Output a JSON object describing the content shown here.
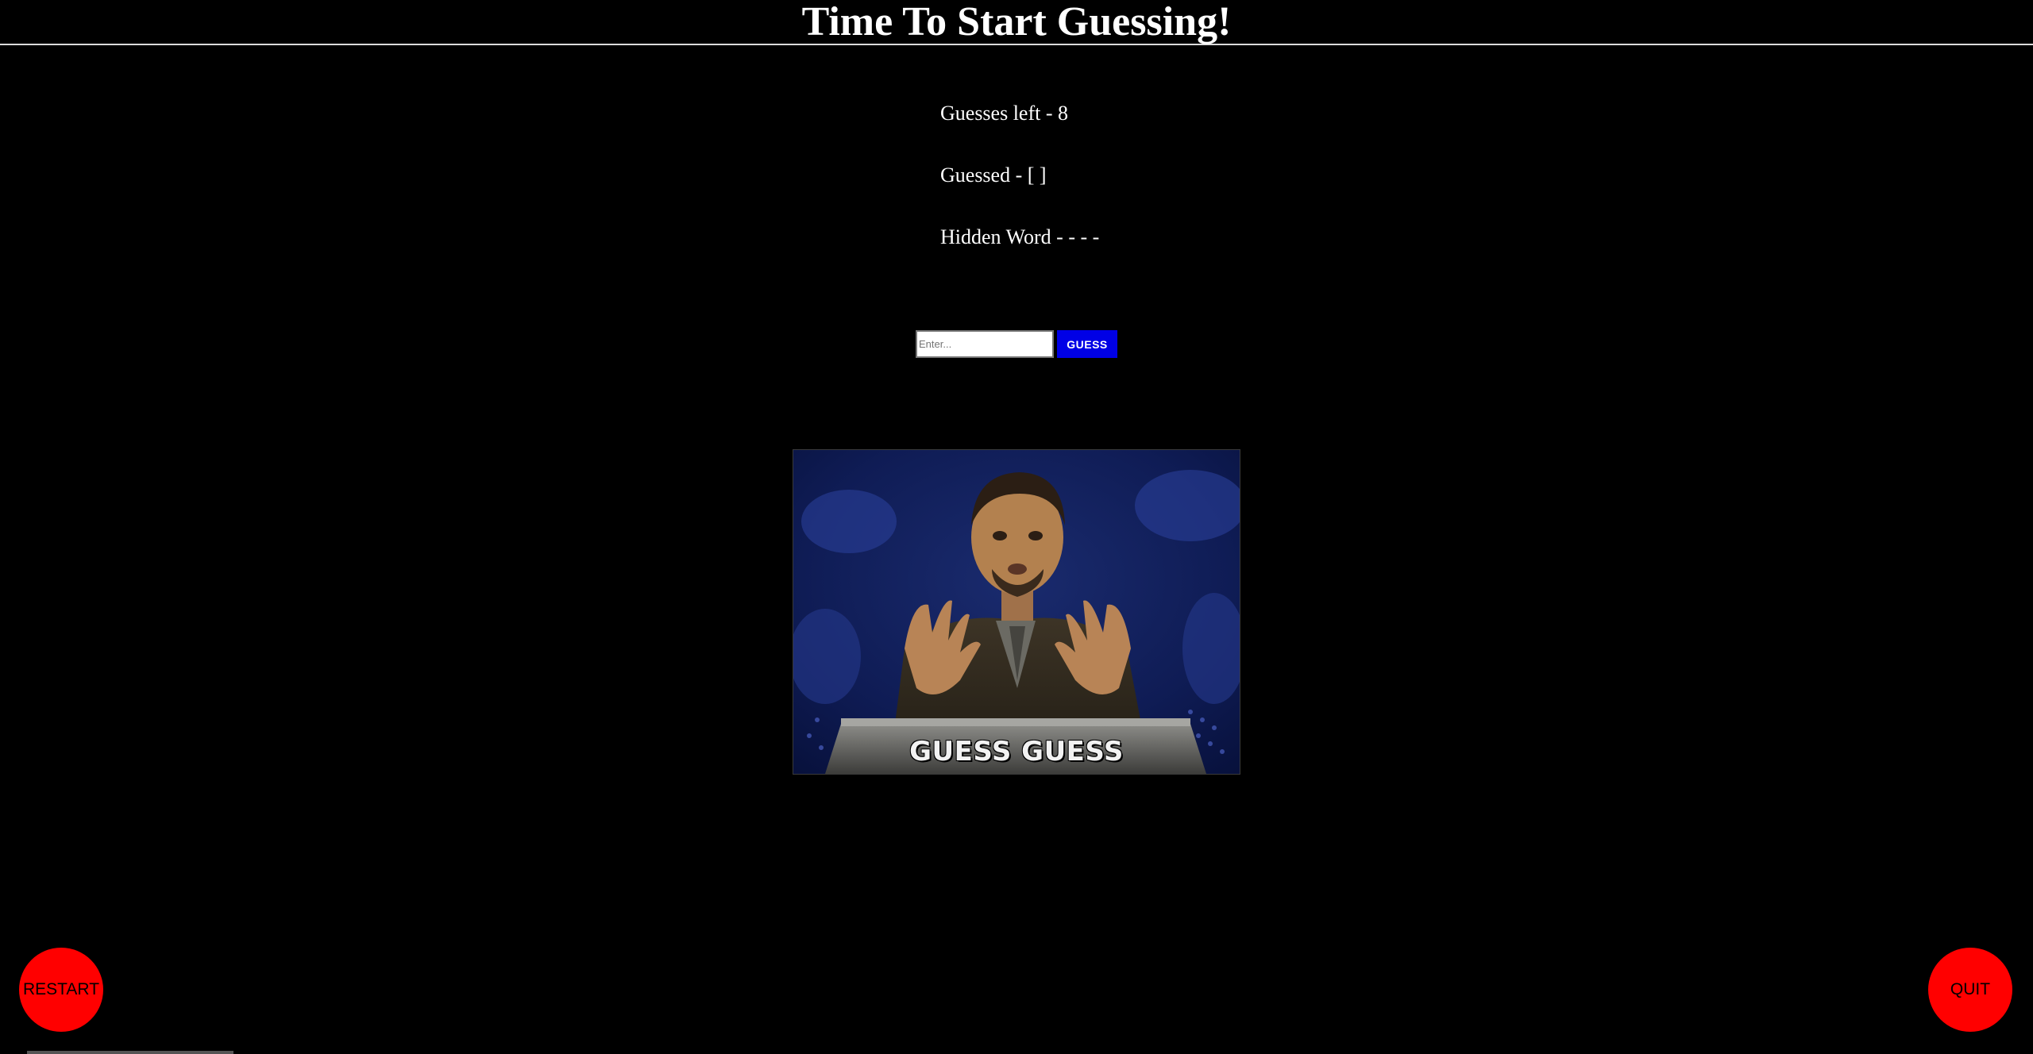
{
  "header": {
    "title": "Time To Start Guessing!"
  },
  "stats": {
    "guesses_left": "Guesses left - 8",
    "guessed": "Guessed - [ ]",
    "hidden_word": "Hidden Word - - - -"
  },
  "form": {
    "input_placeholder": "Enter...",
    "input_value": "",
    "guess_label": "GUESS"
  },
  "gif": {
    "caption": "GUESS GUESS"
  },
  "controls": {
    "restart_label": "RESTART",
    "quit_label": "QUIT"
  },
  "colors": {
    "background": "#000000",
    "guess_button": "#0000e6",
    "control_buttons": "#ff0000"
  }
}
